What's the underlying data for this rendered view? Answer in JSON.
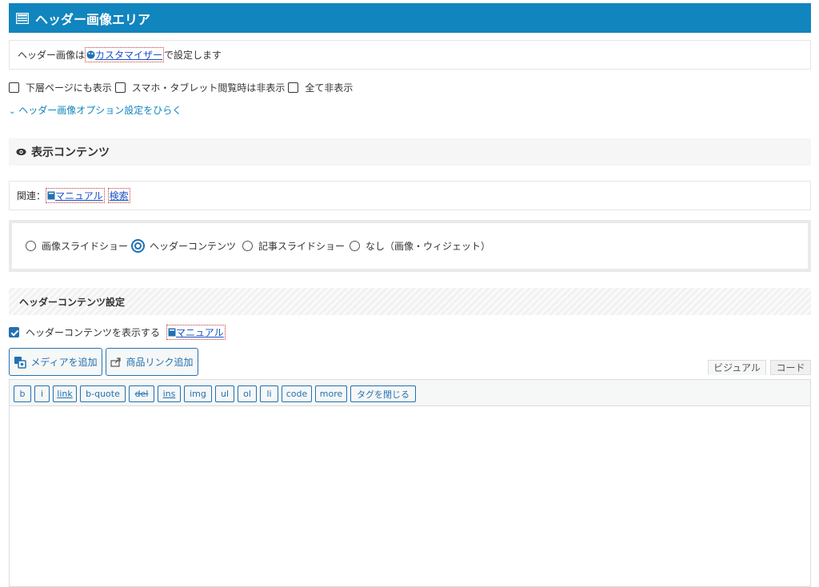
{
  "header": {
    "title": "ヘッダー画像エリア"
  },
  "info1": {
    "prefix": "ヘッダー画像は",
    "link": "カスタマイザー",
    "suffix": "で設定します"
  },
  "checkboxes": [
    {
      "label": "下層ページにも表示",
      "checked": false
    },
    {
      "label": "スマホ・タブレット閲覧時は非表示",
      "checked": false
    },
    {
      "label": "全て非表示",
      "checked": false
    }
  ],
  "options_link": "ヘッダー画像オプション設定をひらく",
  "section": {
    "title": "表示コンテンツ"
  },
  "related": {
    "label": "関連：",
    "manual": "マニュアル",
    "search": "検索"
  },
  "radios": [
    {
      "label": "画像スライドショー",
      "selected": false
    },
    {
      "label": "ヘッダーコンテンツ",
      "selected": true
    },
    {
      "label": "記事スライドショー",
      "selected": false
    },
    {
      "label": "なし（画像・ウィジェット）",
      "selected": false
    }
  ],
  "hc_settings": {
    "title": "ヘッダーコンテンツ設定"
  },
  "show_content": {
    "label": "ヘッダーコンテンツを表示する",
    "checked": true,
    "manual": "マニュアル"
  },
  "buttons": {
    "media": "メディアを追加",
    "product": "商品リンク追加"
  },
  "editor_tabs": {
    "visual": "ビジュアル",
    "code": "コード"
  },
  "quicktags": [
    "b",
    "i",
    "link",
    "b-quote",
    "del",
    "ins",
    "img",
    "ul",
    "ol",
    "li",
    "code",
    "more",
    "タグを閉じる"
  ],
  "colors": {
    "header": "#1185be",
    "accent": "#2271b1",
    "link": "#1a52c9"
  }
}
